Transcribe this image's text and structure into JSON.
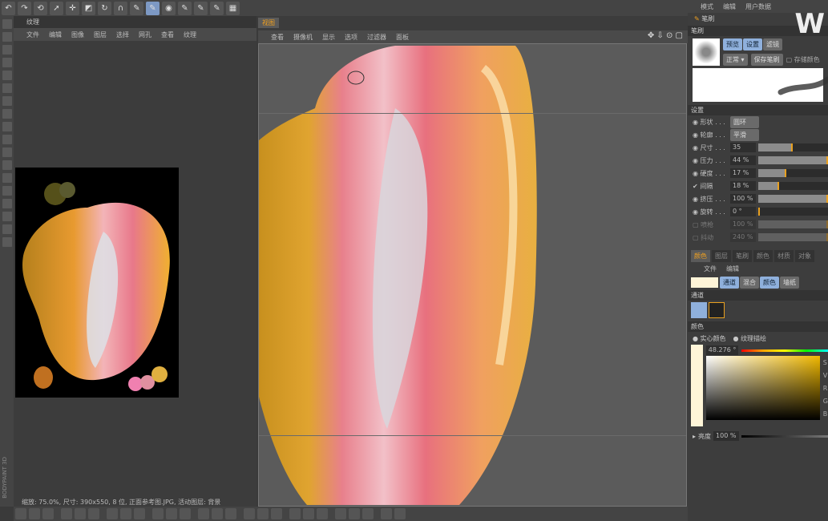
{
  "top_toolbar": {
    "icons": [
      "undo-icon",
      "redo-icon",
      "reset-icon",
      "select-icon",
      "move-icon",
      "scale-icon",
      "rotate-icon",
      "magnet-icon",
      "paint-setup-icon",
      "paint-3d-icon",
      "projection-icon",
      "brush-a-icon",
      "brush-b-icon",
      "brush-c-icon",
      "render-icon"
    ]
  },
  "texture_panel": {
    "title": "纹理",
    "menu": [
      "文件",
      "编辑",
      "图像",
      "图层",
      "选择",
      "网孔",
      "查看",
      "纹理"
    ],
    "status": "缩放: 75.0%, 尺寸: 390x550, 8 位, 正面参考图.JPG, 活动图层: 背景"
  },
  "viewport": {
    "tab": "视图",
    "menu": [
      "查看",
      "摄像机",
      "显示",
      "选项",
      "过滤器",
      "面板"
    ]
  },
  "right_panel": {
    "menu": [
      "模式",
      "编辑",
      "用户数据"
    ],
    "tool": "笔刷",
    "section_brush": "笔刷",
    "brush_tabs": [
      "预览",
      "设置",
      "滤镜"
    ],
    "mode": "正常",
    "save_brush": "保存笔刷",
    "store_label": "存储颜色",
    "section_settings": "设置",
    "settings": [
      {
        "label": "形状 . . .",
        "value": "圆环",
        "type": "select"
      },
      {
        "label": "轮廓 . . .",
        "value": "平滑",
        "type": "select"
      },
      {
        "label": "尺寸 . . .",
        "value": "35",
        "fill": 0.49
      },
      {
        "label": "压力 . . .",
        "value": "44 %",
        "fill": 1.0
      },
      {
        "label": "硬度 . . .",
        "value": "17 %",
        "fill": 0.4
      },
      {
        "label": "间隔",
        "value": "18 %",
        "fill": 0.3,
        "checked": true
      },
      {
        "label": "挤压 . . .",
        "value": "100 %",
        "fill": 1.0
      },
      {
        "label": "旋转 . . .",
        "value": "0 °",
        "fill": 0.0
      },
      {
        "label": "喷枪",
        "value": "100 %",
        "fill": 1.0,
        "disabled": true
      },
      {
        "label": "抖动",
        "value": "240 %",
        "fill": 1.0,
        "disabled": true
      }
    ],
    "color_tabs": [
      "颜色",
      "图层",
      "笔刷",
      "颜色",
      "材质",
      "对象"
    ],
    "color_menu": [
      "文件",
      "编辑"
    ],
    "color_buttons": [
      "通道",
      "混合",
      "颜色",
      "墙纸"
    ],
    "section_channels": "通道",
    "section_color": "颜色",
    "solid_color": "实心颜色",
    "texture_fill": "纹理描绘",
    "hue": "48.276 °",
    "channels": [
      "S",
      "V",
      "R",
      "G",
      "B"
    ],
    "brightness_label": "亮度",
    "brightness": "100 %",
    "current_color": "#fff5d8"
  },
  "app_label": "BODYPAINT 3D",
  "colors": {
    "accent": "#f0a020",
    "selected": "#8fb0dc"
  }
}
